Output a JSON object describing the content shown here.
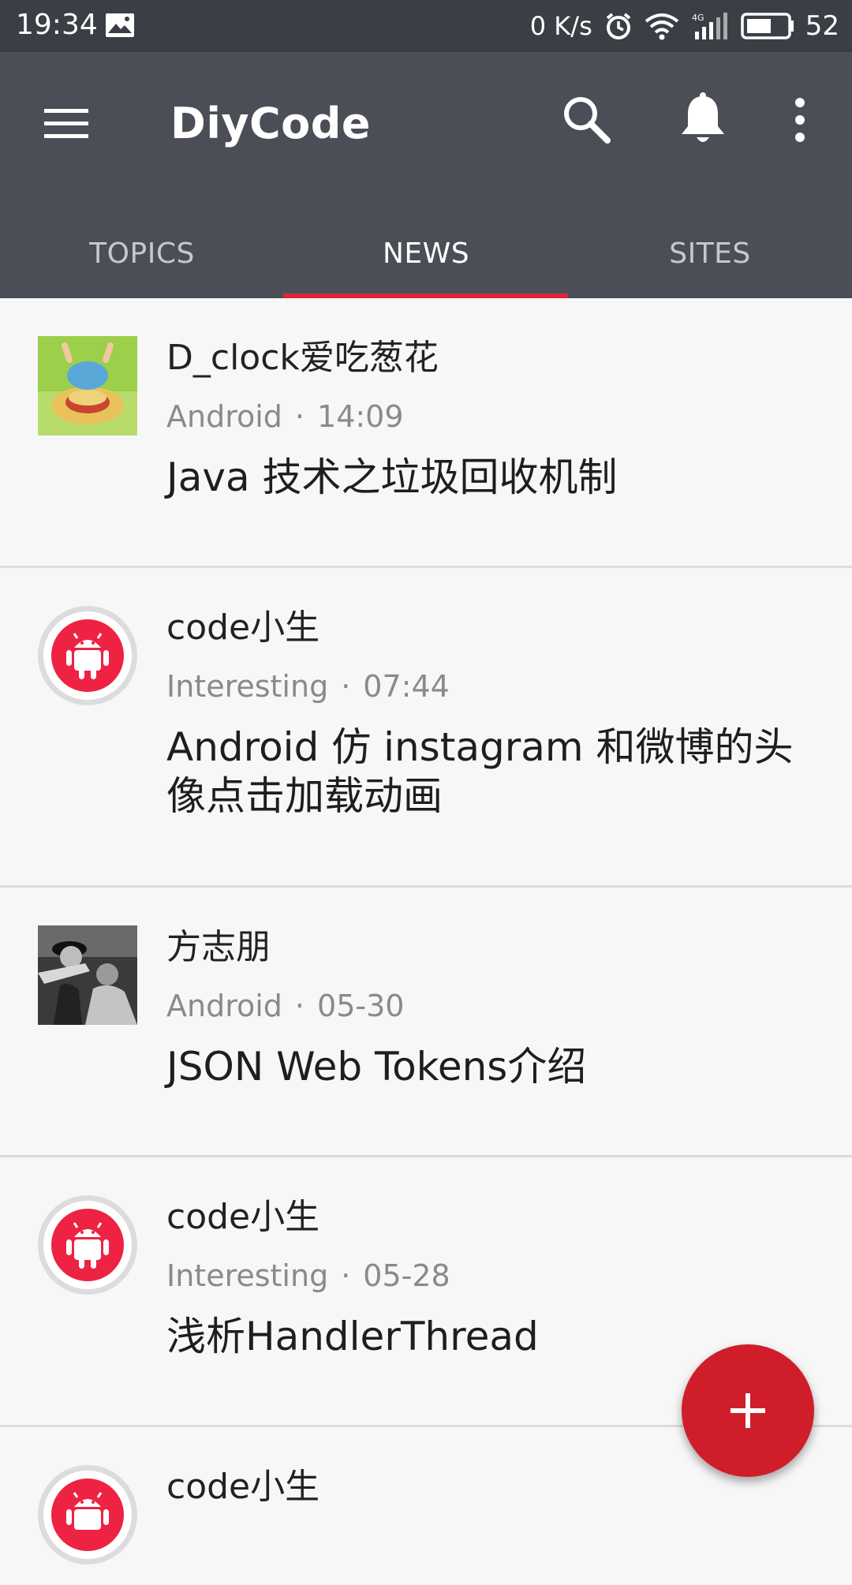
{
  "status_bar": {
    "time": "19:34",
    "net_speed": "0 K/s",
    "battery": "52",
    "icons": [
      "image-icon",
      "alarm-icon",
      "wifi-icon",
      "signal-4g-icon",
      "battery-icon"
    ]
  },
  "app_bar": {
    "title": "DiyCode",
    "actions": [
      "menu-icon",
      "search-icon",
      "notification-bell-icon",
      "more-vert-icon"
    ]
  },
  "tabs": [
    {
      "label": "TOPICS",
      "active": false
    },
    {
      "label": "NEWS",
      "active": true
    },
    {
      "label": "SITES",
      "active": false
    }
  ],
  "news": [
    {
      "author": "D_clock爱吃葱花",
      "node": "Android",
      "time": "14:09",
      "title": "Java 技术之垃圾回收机制"
    },
    {
      "author": "code小生",
      "node": "Interesting",
      "time": "07:44",
      "title": "Android 仿 instagram 和微博的头像点击加载动画"
    },
    {
      "author": "方志朋",
      "node": "Android",
      "time": "05-30",
      "title": "JSON Web Tokens介绍"
    },
    {
      "author": "code小生",
      "node": "Interesting",
      "time": "05-28",
      "title": "浅析HandlerThread"
    },
    {
      "author": "code小生",
      "node": "",
      "time": "",
      "title": ""
    }
  ],
  "fab": {
    "icon": "add-icon",
    "label": "+"
  },
  "colors": {
    "app_bar": "#4b4e56",
    "status_bar": "#3b3e45",
    "accent": "#e0243a",
    "fab": "#cf1e2a"
  }
}
